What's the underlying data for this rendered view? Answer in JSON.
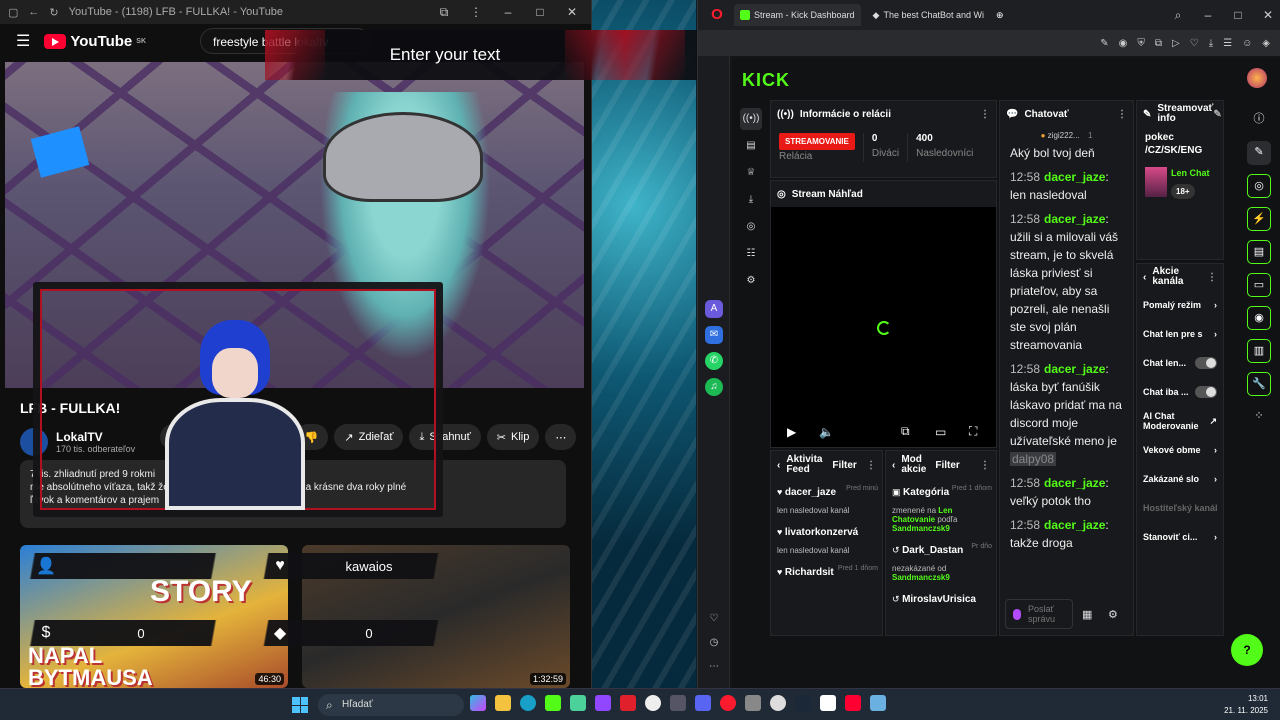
{
  "youtube": {
    "window_title": "YouTube - (1198) LFB - FULLKA! - YouTube",
    "logo_text": "YouTube",
    "logo_region": "SK",
    "search_value": "freestyle battle lokaltv",
    "video_title": "LFB - FULLKA!",
    "channel_name": "LokalTV",
    "channel_subs": "170 tis. odberateľov",
    "actions": {
      "share": "Zdieľať",
      "download": "Stiahnuť",
      "clip": "Klip"
    },
    "description_lines": [
      "7 tis. zhliadnutí  pred 9 rokmi",
      "me absolútneho víťaza, takž                              že, ako to celé dopadlo! Ďakuje za krásne dva roky plné",
      "ľávok a komentárov a prajem"
    ],
    "thumbs": [
      {
        "title_top": "STORY",
        "title_bottom": "NAPAL BYTMAUSA",
        "duration": "46:30"
      },
      {
        "duration": "1:32:59"
      }
    ]
  },
  "overlay": {
    "text_left": "Enter your text",
    "text_right": "Enter your text",
    "bar1_value": "",
    "bar2_value": "kawaios",
    "bar3_value": "0",
    "bar4_value": "0"
  },
  "kick": {
    "tabs": [
      "Stream - Kick Dashboard",
      "The best ChatBot and Wi"
    ],
    "logo": "KICK",
    "info_panel": {
      "title": "Informácie o relácii",
      "badge": "STREAMOVANIE",
      "badge_label": "Relácia",
      "viewers": "0",
      "viewers_label": "Diváci",
      "followers": "400",
      "followers_label": "Nasledovníci"
    },
    "preview_title": "Stream Náhľad",
    "chat": {
      "title": "Chatovať",
      "pinned": "zigi222...",
      "pinned_count": "1",
      "first_line": "Aký bol tvoj deň",
      "messages": [
        {
          "time": "12:58",
          "user": "dacer_jaze",
          "text": "len nasledoval"
        },
        {
          "time": "12:58",
          "user": "dacer_jaze",
          "text": "užili si a milovali váš stream, je to skvelá láska priviesť si priateľov, aby sa pozreli, ale nenašli ste svoj plán streamovania"
        },
        {
          "time": "12:58",
          "user": "dacer_jaze",
          "text": "láska byť fanúšik láskavo pridať ma na discord moje užívateľské meno je",
          "highlight": "dalpy08"
        },
        {
          "time": "12:58",
          "user": "dacer_jaze",
          "text": "veľký potok tho"
        },
        {
          "time": "12:58",
          "user": "dacer_jaze",
          "text": "takže droga"
        }
      ],
      "input_placeholder": "Poslať správu"
    },
    "activity": {
      "title": "Aktivita Feed",
      "filter": "Filter",
      "items": [
        {
          "name": "dacer_jaze",
          "time": "Pred minú",
          "sub": "len nasledoval kanál"
        },
        {
          "name": "livatorkonzervá",
          "time": "",
          "sub": "len nasledoval kanál"
        },
        {
          "name": "Richardsit",
          "time": "Pred 1 dňom",
          "sub": ""
        }
      ]
    },
    "mod": {
      "title": "Mod akcie",
      "filter": "Filter",
      "items": [
        {
          "name": "Kategória",
          "time": "Pred 1 dňom",
          "sub": "zmenené na",
          "green": "Len Chatovanie",
          "sub2": "podľa",
          "green2": "Sandmanczsk9"
        },
        {
          "name": "Dark_Dastan",
          "time": "Pr dňo",
          "sub": "nezakázané od",
          "green": "",
          "sub2": "",
          "green2": "Sandmanczsk9"
        },
        {
          "name": "MiroslavUrisica",
          "time": "",
          "sub": "",
          "green": "",
          "sub2": "",
          "green2": ""
        }
      ]
    },
    "stream_info": {
      "title": "Streamovať info",
      "body": "pokec /CZ/SK/ENG",
      "category": "Len Chat",
      "badge": "18+"
    },
    "channel_actions": {
      "title": "Akcie kanála",
      "items": [
        {
          "label": "Pomalý režim",
          "kind": "arrow"
        },
        {
          "label": "Chat len pre s",
          "kind": "arrow"
        },
        {
          "label": "Chat len...",
          "kind": "toggle"
        },
        {
          "label": "Chat iba ...",
          "kind": "toggle"
        },
        {
          "label": "AI Chat Moderovanie",
          "kind": "link"
        },
        {
          "label": "Vekové obme",
          "kind": "arrow"
        },
        {
          "label": "Zakázané slo",
          "kind": "arrow"
        },
        {
          "label": "Hostiteľský kanál",
          "kind": "dim"
        },
        {
          "label": "Stanoviť ci...",
          "kind": "arrow"
        }
      ]
    }
  },
  "taskbar": {
    "search": "Hľadať",
    "time": "13:01",
    "date": "21. 11. 2025"
  },
  "colors": {
    "kick_green": "#53fc18",
    "youtube_red": "#ff0033",
    "stream_red": "#e91916"
  }
}
